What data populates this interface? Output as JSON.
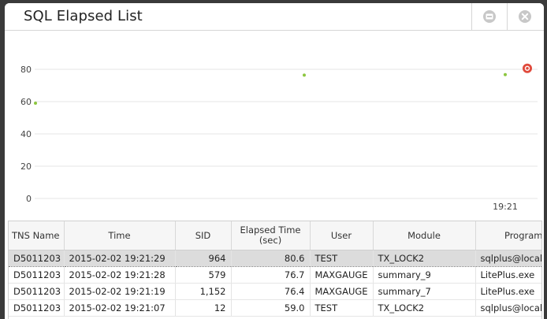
{
  "window": {
    "title": "SQL Elapsed List"
  },
  "chart_data": {
    "type": "scatter",
    "ylim": [
      0,
      90
    ],
    "yticks": [
      0,
      20,
      40,
      60,
      80
    ],
    "xtick_label": "19:21",
    "points": [
      {
        "time": "2015-02-02 19:21:07",
        "value": 59.0
      },
      {
        "time": "2015-02-02 19:21:19",
        "value": 76.4
      },
      {
        "time": "2015-02-02 19:21:28",
        "value": 76.7
      },
      {
        "time": "2015-02-02 19:21:29",
        "value": 80.6,
        "highlighted": true
      }
    ],
    "point_color": "#8cc63f",
    "highlight_color": "#e04a3c"
  },
  "table": {
    "columns": [
      "TNS Name",
      "Time",
      "SID",
      "Elapsed Time\n(sec)",
      "User",
      "Module",
      "Program"
    ],
    "rows": [
      [
        "D5011203",
        "2015-02-02 19:21:29",
        "964",
        "80.6",
        "TEST",
        "TX_LOCK2",
        "sqlplus@localh"
      ],
      [
        "D5011203",
        "2015-02-02 19:21:28",
        "579",
        "76.7",
        "MAXGAUGE",
        "summary_9",
        "LitePlus.exe"
      ],
      [
        "D5011203",
        "2015-02-02 19:21:19",
        "1,152",
        "76.4",
        "MAXGAUGE",
        "summary_7",
        "LitePlus.exe"
      ],
      [
        "D5011203",
        "2015-02-02 19:21:07",
        "12",
        "59.0",
        "TEST",
        "TX_LOCK2",
        "sqlplus@localh"
      ]
    ],
    "selected_row": 0
  }
}
